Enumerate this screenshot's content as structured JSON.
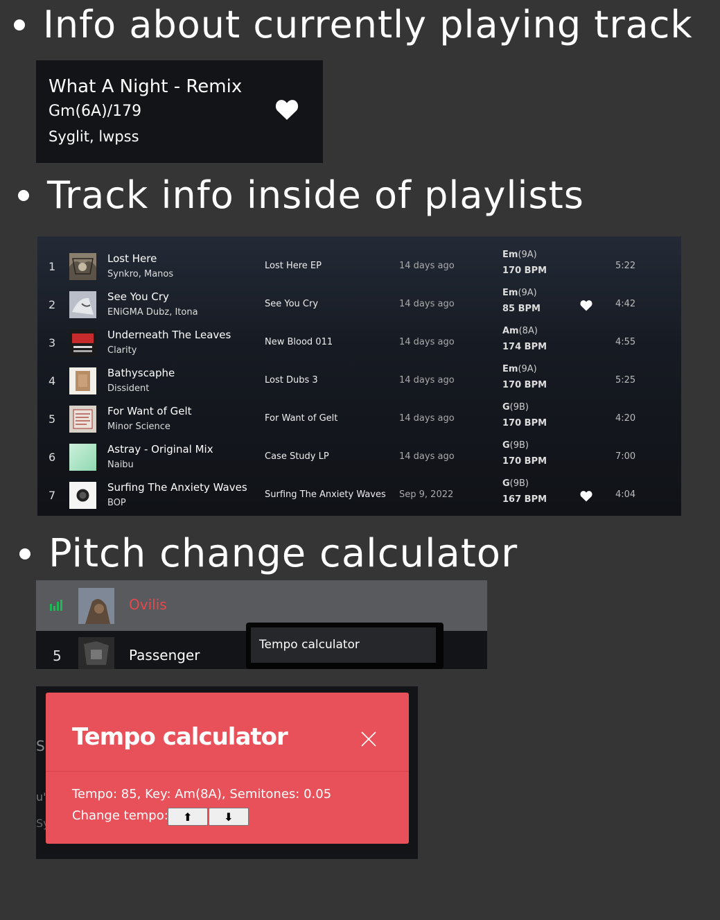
{
  "headings": {
    "now_playing": "Info about currently playing track",
    "playlist": "Track info inside of playlists",
    "pitch": "Pitch change calculator"
  },
  "now_playing": {
    "title": "What A Night - Remix",
    "key_bpm": "Gm(6A)/179",
    "artists": "Syglit, lwpss",
    "liked": true,
    "heart_icon": "heart-icon"
  },
  "playlist": {
    "rows": [
      {
        "num": "1",
        "title": "Lost Here",
        "artist": "Synkro, Manos",
        "album": "Lost Here EP",
        "added": "14 days ago",
        "key_main": "Em",
        "key_camelot": "(9A)",
        "bpm": "170 BPM",
        "liked": false,
        "duration": "5:22"
      },
      {
        "num": "2",
        "title": "See You Cry",
        "artist": "ENiGMA Dubz, Itona",
        "album": "See You Cry",
        "added": "14 days ago",
        "key_main": "Em",
        "key_camelot": "(9A)",
        "bpm": "85 BPM",
        "liked": true,
        "duration": "4:42"
      },
      {
        "num": "3",
        "title": "Underneath The Leaves",
        "artist": "Clarity",
        "album": "New Blood 011",
        "added": "14 days ago",
        "key_main": "Am",
        "key_camelot": "(8A)",
        "bpm": "174 BPM",
        "liked": false,
        "duration": "4:55"
      },
      {
        "num": "4",
        "title": "Bathyscaphe",
        "artist": "Dissident",
        "album": "Lost Dubs 3",
        "added": "14 days ago",
        "key_main": "Em",
        "key_camelot": "(9A)",
        "bpm": "170 BPM",
        "liked": false,
        "duration": "5:25"
      },
      {
        "num": "5",
        "title": "For Want of Gelt",
        "artist": "Minor Science",
        "album": "For Want of Gelt",
        "added": "14 days ago",
        "key_main": "G",
        "key_camelot": "(9B)",
        "bpm": "170 BPM",
        "liked": false,
        "duration": "4:20"
      },
      {
        "num": "6",
        "title": "Astray - Original Mix",
        "artist": "Naibu",
        "album": "Case Study LP",
        "added": "14 days ago",
        "key_main": "G",
        "key_camelot": "(9B)",
        "bpm": "170 BPM",
        "liked": false,
        "duration": "7:00"
      },
      {
        "num": "7",
        "title": "Surfing The Anxiety Waves",
        "artist": "BOP",
        "album": "Surfing The Anxiety Waves",
        "added": "Sep 9, 2022",
        "key_main": "G",
        "key_camelot": "(9B)",
        "bpm": "167 BPM",
        "liked": true,
        "duration": "4:04"
      }
    ]
  },
  "context_menu": {
    "playing_title": "Ovilis",
    "next_num": "5",
    "next_title": "Passenger",
    "menu_item": "Tempo calculator",
    "playing_icon": "equalizer-icon",
    "accent_color": "#e5484d"
  },
  "dialog": {
    "title": "Tempo calculator",
    "info": "Tempo: 85, Key: Am(8A), Semitones: 0.05",
    "change_label": "Change tempo:",
    "up_label": "⬆",
    "down_label": "⬇",
    "close_icon": "close-icon",
    "bg_color": "#e9515a",
    "ghost_text": [
      "S",
      "u'",
      "Sy"
    ]
  }
}
